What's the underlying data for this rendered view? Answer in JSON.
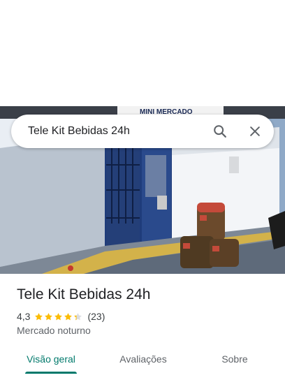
{
  "search": {
    "query": "Tele Kit Bebidas 24h",
    "search_icon": "search-icon",
    "close_icon": "close-icon"
  },
  "hero": {
    "sign_text": "MINI MERCADO"
  },
  "place": {
    "name": "Tele Kit Bebidas 24h",
    "rating_text": "4,3",
    "rating_value": 4.3,
    "review_count_text": "(23)",
    "category": "Mercado noturno"
  },
  "tabs": [
    {
      "label": "Visão geral",
      "active": true
    },
    {
      "label": "Avaliações",
      "active": false
    },
    {
      "label": "Sobre",
      "active": false
    }
  ],
  "colors": {
    "accent": "#00796b",
    "star": "#fbbc04",
    "star_empty": "#dadce0"
  }
}
